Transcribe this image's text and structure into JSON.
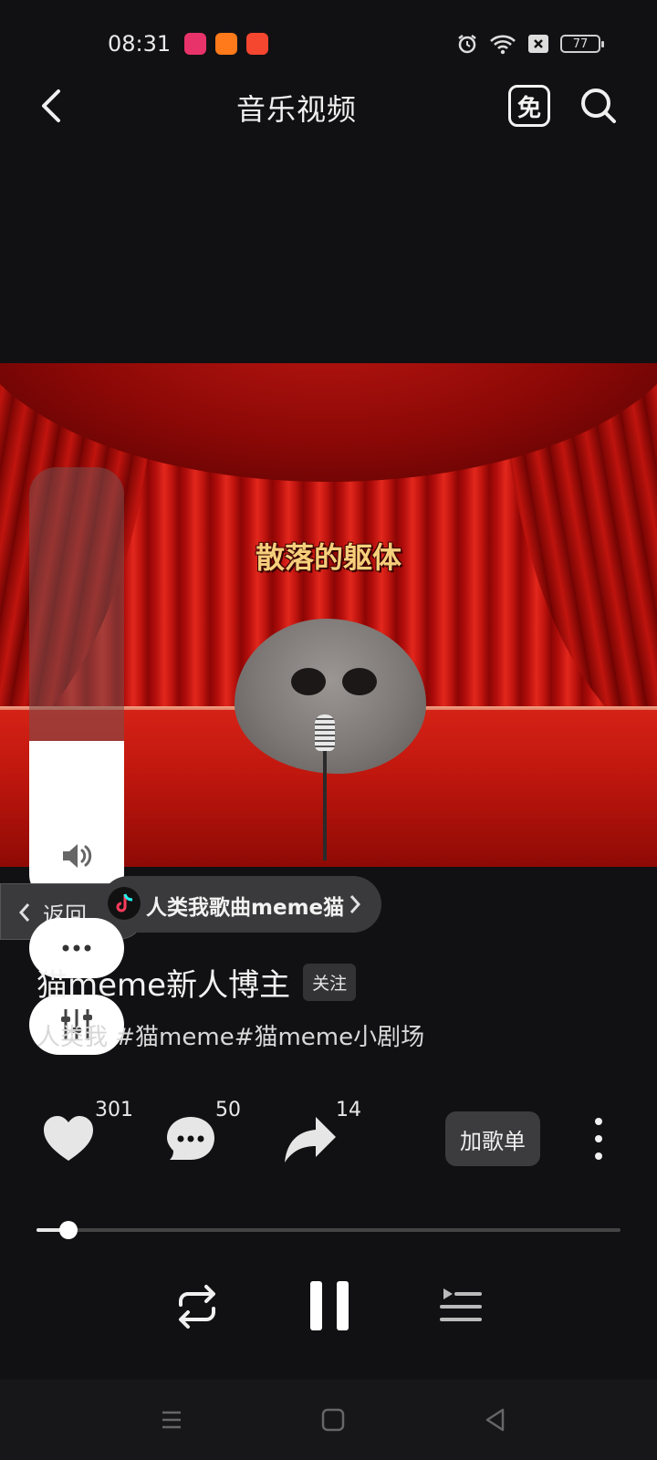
{
  "status_bar": {
    "time": "08:31",
    "battery": "77",
    "icons": [
      "app-icon-1",
      "app-icon-2",
      "app-icon-3",
      "alarm-icon",
      "wifi-icon",
      "sim-x-icon",
      "battery-icon"
    ],
    "app_colors": [
      "#e8336a",
      "#ff7a1a",
      "#f5462f"
    ]
  },
  "header": {
    "title": "音乐视频",
    "free_label": "免"
  },
  "video": {
    "subtitle": "散落的躯体",
    "volume_level": 0.37
  },
  "overlay": {
    "back_label": "返回",
    "tag_label": "人类我歌曲meme猫"
  },
  "post": {
    "author": "猫meme新人博主",
    "follow_label": "关注",
    "description": "人类我 #猫meme#猫meme小剧场"
  },
  "actions": {
    "likes": "301",
    "comments": "50",
    "shares": "14",
    "add_playlist_label": "加歌单"
  },
  "player": {
    "progress": 0.055
  },
  "colors": {
    "background": "#111113",
    "curtain": "#c0140e",
    "subtitle": "#f6cf7b"
  }
}
